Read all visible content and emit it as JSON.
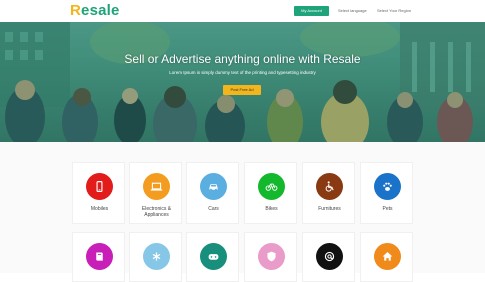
{
  "header": {
    "logo_first": "R",
    "logo_rest": "esale",
    "account_label": "My Account",
    "language_label": "Select language",
    "region_label": "Select Your Region"
  },
  "hero": {
    "title": "Sell or Advertise anything online with Resale",
    "subtitle": "Lorem Ipsum is simply dummy text of the printing and typesetting industry",
    "cta_label": "Post Free Ad"
  },
  "categories": [
    {
      "label": "Mobiles",
      "icon": "mobile-icon",
      "color": "#e21b1b"
    },
    {
      "label": "Electronics & Appliances",
      "icon": "laptop-icon",
      "color": "#f39c1f"
    },
    {
      "label": "Cars",
      "icon": "car-icon",
      "color": "#5aaee0"
    },
    {
      "label": "Bikes",
      "icon": "bicycle-icon",
      "color": "#13b82c"
    },
    {
      "label": "Furnitures",
      "icon": "wheelchair-icon",
      "color": "#8a3a12"
    },
    {
      "label": "Pets",
      "icon": "paw-icon",
      "color": "#1a73c9"
    },
    {
      "label": "",
      "icon": "book-icon",
      "color": "#c71fb8"
    },
    {
      "label": "",
      "icon": "asterisk-icon",
      "color": "#86c7e8"
    },
    {
      "label": "",
      "icon": "gamepad-icon",
      "color": "#178f7c"
    },
    {
      "label": "",
      "icon": "shield-icon",
      "color": "#e99bc9"
    },
    {
      "label": "",
      "icon": "at-icon",
      "color": "#111111"
    },
    {
      "label": "",
      "icon": "home-icon",
      "color": "#f08a1a"
    }
  ]
}
